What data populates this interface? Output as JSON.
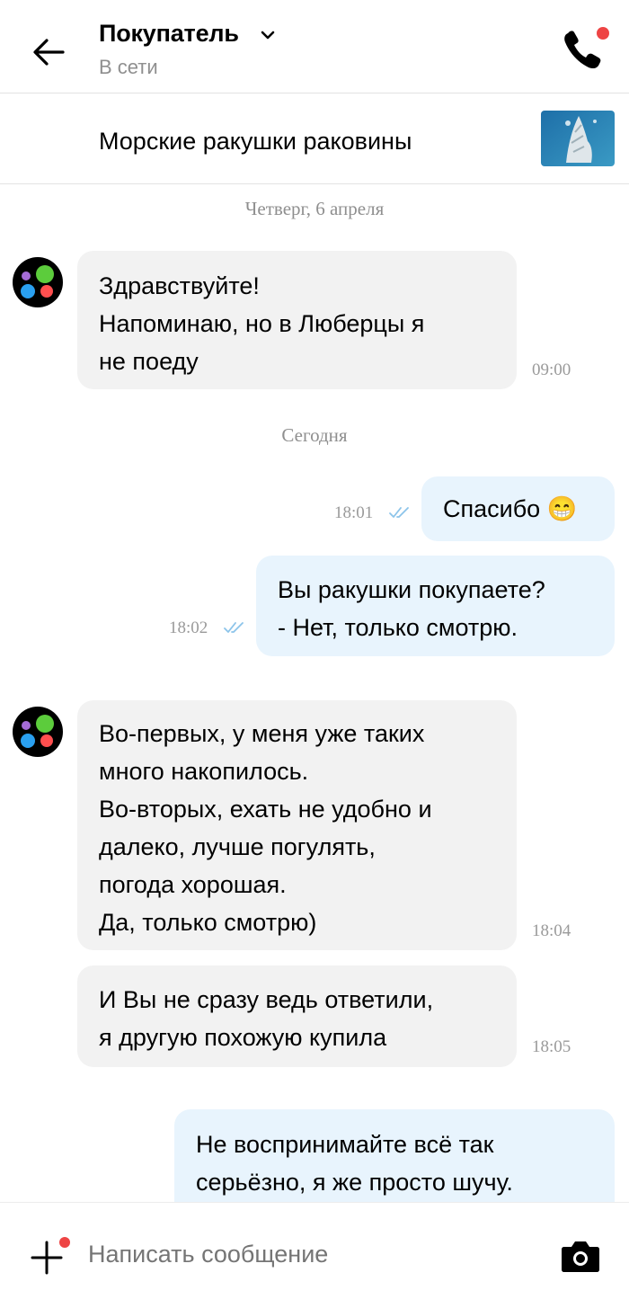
{
  "header": {
    "title": "Покупатель",
    "status": "В сети"
  },
  "product": {
    "name": "Морские ракушки раковины"
  },
  "dates": {
    "first": "Четверг, 6 апреля",
    "second": "Сегодня"
  },
  "messages": [
    {
      "direction": "in",
      "text": "Здравствуйте!\nНапоминаю, но в Люберцы я\nне поеду",
      "time": "09:00"
    },
    {
      "direction": "out",
      "text": "Спасибо 😁",
      "time": "18:01"
    },
    {
      "direction": "out",
      "text": "Вы ракушки покупаете?\n- Нет, только смотрю.",
      "time": "18:02"
    },
    {
      "direction": "in",
      "text": "Во-первых, у меня уже таких\nмного накопилось.\nВо-вторых, ехать не удобно и\nдалеко, лучше погулять,\nпогода хорошая.\nДа, только смотрю)",
      "time": "18:04"
    },
    {
      "direction": "in",
      "text": "И Вы не сразу ведь ответили,\nя другую похожую купила",
      "time": "18:05"
    },
    {
      "direction": "out",
      "text": "Не воспринимайте всё так\nсерьёзно, я же просто шучу.",
      "time": ""
    }
  ],
  "composer": {
    "placeholder": "Написать сообщение"
  },
  "colors": {
    "incoming_bubble": "#f2f2f2",
    "outgoing_bubble": "#e8f4fd",
    "notification_dot": "#ee4444",
    "read_ticks": "#8cc4ea"
  },
  "icons": [
    "back-arrow-icon",
    "chevron-down-icon",
    "phone-icon",
    "plus-icon",
    "camera-icon",
    "read-ticks-icon"
  ]
}
